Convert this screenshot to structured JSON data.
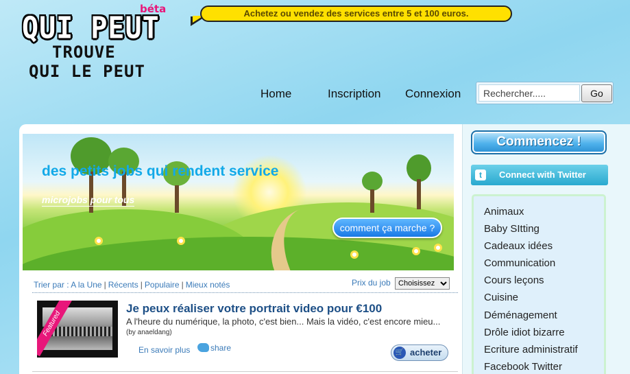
{
  "logo": {
    "beta": "béta",
    "line1": "QUI PEUT",
    "line2": "TROUVE",
    "line3": "QUI LE PEUT"
  },
  "banner": {
    "text": "Achetez ou vendez des services entre 5 et 100 euros."
  },
  "nav": {
    "home": "Home",
    "signup": "Inscription",
    "login": "Connexion"
  },
  "search": {
    "placeholder": "Rechercher.....",
    "value": "Rechercher.....",
    "button": "Go"
  },
  "hero": {
    "tagline": "des petits jobs qui rendent service",
    "subtitle": "microjobs pour tous",
    "how_button": "comment ça marche ?"
  },
  "sort": {
    "label": "Trier par :",
    "options": [
      "A la Une",
      "Récents",
      "Populaire",
      "Mieux notés"
    ],
    "price_label": "Prix du job",
    "price_select": "Choisissez"
  },
  "job": {
    "featured": "Featured",
    "title": "Je peux réaliser votre portrait video pour €100",
    "description": "A l'heure du numérique, la photo, c'est bien... Mais la vidéo, c'est encore mieu...",
    "author": "(by anaeldang)",
    "more": "En savoir plus",
    "share": "share",
    "buy": "acheter"
  },
  "sidebar": {
    "start_button": "Commencez !",
    "twitter_button": "Connect with Twitter",
    "categories": [
      "Animaux",
      "Baby SItting",
      "Cadeaux idées",
      "Communication",
      "Cours leçons",
      "Cuisine",
      "Déménagement",
      "Drôle idiot bizarre",
      "Ecriture administratif",
      "Facebook Twitter"
    ]
  },
  "colors": {
    "accent_blue": "#12a9e8",
    "brand_pink": "#e8177a",
    "banner_yellow": "#ffe000"
  }
}
